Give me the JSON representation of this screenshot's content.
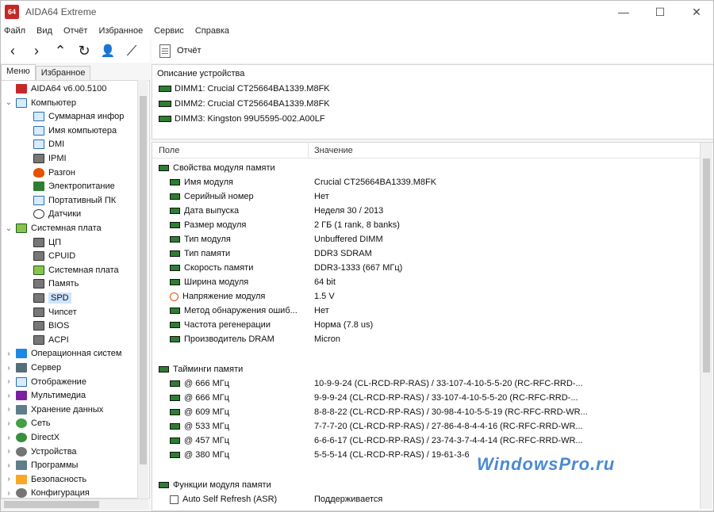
{
  "window": {
    "title": "AIDA64 Extreme",
    "min": "—",
    "max": "☐",
    "close": "✕",
    "logo_text": "64"
  },
  "menu": [
    "Файл",
    "Вид",
    "Отчёт",
    "Избранное",
    "Сервис",
    "Справка"
  ],
  "toolbar": {
    "back": "‹",
    "forward": "›",
    "up": "⌃",
    "refresh": "↻",
    "user": "👤",
    "chart": "⟋",
    "report_label": "Отчёт"
  },
  "tabs": {
    "menu": "Меню",
    "favorites": "Избранное"
  },
  "tree": [
    {
      "label": "AIDA64 v6.00.5100",
      "icon": "logo-icon",
      "level": 0,
      "expander": ""
    },
    {
      "label": "Компьютер",
      "icon": "monitor-icon",
      "level": 0,
      "expander": "⌄"
    },
    {
      "label": "Суммарная инфор",
      "icon": "monitor-icon",
      "level": 1,
      "expander": ""
    },
    {
      "label": "Имя компьютера",
      "icon": "monitor-icon",
      "level": 1,
      "expander": ""
    },
    {
      "label": "DMI",
      "icon": "monitor-icon",
      "level": 1,
      "expander": ""
    },
    {
      "label": "IPMI",
      "icon": "chip-icon",
      "level": 1,
      "expander": ""
    },
    {
      "label": "Разгон",
      "icon": "flame-icon",
      "level": 1,
      "expander": ""
    },
    {
      "label": "Электропитание",
      "icon": "plug-icon",
      "level": 1,
      "expander": ""
    },
    {
      "label": "Портативный ПК",
      "icon": "monitor-icon",
      "level": 1,
      "expander": ""
    },
    {
      "label": "Датчики",
      "icon": "clock-icon",
      "level": 1,
      "expander": ""
    },
    {
      "label": "Системная плата",
      "icon": "board-icon",
      "level": 0,
      "expander": "⌄"
    },
    {
      "label": "ЦП",
      "icon": "chip-icon",
      "level": 1,
      "expander": ""
    },
    {
      "label": "CPUID",
      "icon": "chip-icon",
      "level": 1,
      "expander": ""
    },
    {
      "label": "Системная плата",
      "icon": "board-icon",
      "level": 1,
      "expander": ""
    },
    {
      "label": "Память",
      "icon": "chip-icon",
      "level": 1,
      "expander": ""
    },
    {
      "label": "SPD",
      "icon": "chip-icon",
      "level": 1,
      "expander": "",
      "selected": true
    },
    {
      "label": "Чипсет",
      "icon": "chip-icon",
      "level": 1,
      "expander": ""
    },
    {
      "label": "BIOS",
      "icon": "chip-icon",
      "level": 1,
      "expander": ""
    },
    {
      "label": "ACPI",
      "icon": "chip-icon",
      "level": 1,
      "expander": ""
    },
    {
      "label": "Операционная систем",
      "icon": "windows-icon",
      "level": 0,
      "expander": "›"
    },
    {
      "label": "Сервер",
      "icon": "server-icon",
      "level": 0,
      "expander": "›"
    },
    {
      "label": "Отображение",
      "icon": "monitor-icon",
      "level": 0,
      "expander": "›"
    },
    {
      "label": "Мультимедиа",
      "icon": "media-icon",
      "level": 0,
      "expander": "›"
    },
    {
      "label": "Хранение данных",
      "icon": "storage-icon",
      "level": 0,
      "expander": "›"
    },
    {
      "label": "Сеть",
      "icon": "globe-icon",
      "level": 0,
      "expander": "›"
    },
    {
      "label": "DirectX",
      "icon": "xbox-icon",
      "level": 0,
      "expander": "›"
    },
    {
      "label": "Устройства",
      "icon": "gear-icon",
      "level": 0,
      "expander": "›"
    },
    {
      "label": "Программы",
      "icon": "storage-icon",
      "level": 0,
      "expander": "›"
    },
    {
      "label": "Безопасность",
      "icon": "shield-icon",
      "level": 0,
      "expander": "›"
    },
    {
      "label": "Конфигурация",
      "icon": "gear-icon",
      "level": 0,
      "expander": "›"
    }
  ],
  "device_description": {
    "header": "Описание устройства",
    "items": [
      "DIMM1: Crucial CT25664BA1339.M8FK",
      "DIMM2: Crucial CT25664BA1339.M8FK",
      "DIMM3: Kingston 99U5595-002.A00LF"
    ]
  },
  "columns": {
    "field": "Поле",
    "value": "Значение"
  },
  "groups": [
    {
      "title": "Свойства модуля памяти",
      "rows": [
        {
          "field": "Имя модуля",
          "value": "Crucial CT25664BA1339.M8FK",
          "icon": "ram"
        },
        {
          "field": "Серийный номер",
          "value": "Нет",
          "icon": "ram"
        },
        {
          "field": "Дата выпуска",
          "value": "Неделя 30 / 2013",
          "icon": "ram"
        },
        {
          "field": "Размер модуля",
          "value": "2 ГБ (1 rank, 8 banks)",
          "icon": "ram"
        },
        {
          "field": "Тип модуля",
          "value": "Unbuffered DIMM",
          "icon": "ram"
        },
        {
          "field": "Тип памяти",
          "value": "DDR3 SDRAM",
          "icon": "ram"
        },
        {
          "field": "Скорость памяти",
          "value": "DDR3-1333 (667 МГц)",
          "icon": "ram"
        },
        {
          "field": "Ширина модуля",
          "value": "64 bit",
          "icon": "ram"
        },
        {
          "field": "Напряжение модуля",
          "value": "1.5 V",
          "icon": "volt"
        },
        {
          "field": "Метод обнаружения ошиб...",
          "value": "Нет",
          "icon": "ram"
        },
        {
          "field": "Частота регенерации",
          "value": "Норма (7.8 us)",
          "icon": "ram"
        },
        {
          "field": "Производитель DRAM",
          "value": "Micron",
          "icon": "ram"
        }
      ]
    },
    {
      "title": "Тайминги памяти",
      "rows": [
        {
          "field": "@ 666 МГц",
          "value": "10-9-9-24  (CL-RCD-RP-RAS) / 33-107-4-10-5-5-20  (RC-RFC-RRD-...",
          "icon": "ram"
        },
        {
          "field": "@ 666 МГц",
          "value": "9-9-9-24  (CL-RCD-RP-RAS) / 33-107-4-10-5-5-20  (RC-RFC-RRD-...",
          "icon": "ram"
        },
        {
          "field": "@ 609 МГц",
          "value": "8-8-8-22  (CL-RCD-RP-RAS) / 30-98-4-10-5-5-19  (RC-RFC-RRD-WR...",
          "icon": "ram"
        },
        {
          "field": "@ 533 МГц",
          "value": "7-7-7-20  (CL-RCD-RP-RAS) / 27-86-4-8-4-4-16  (RC-RFC-RRD-WR...",
          "icon": "ram"
        },
        {
          "field": "@ 457 МГц",
          "value": "6-6-6-17  (CL-RCD-RP-RAS) / 23-74-3-7-4-4-14  (RC-RFC-RRD-WR...",
          "icon": "ram"
        },
        {
          "field": "@ 380 МГц",
          "value": "5-5-5-14  (CL-RCD-RP-RAS) / 19-61-3-6",
          "icon": "ram"
        }
      ]
    },
    {
      "title": "Функции модуля памяти",
      "rows": [
        {
          "field": "Auto Self Refresh (ASR)",
          "value": "Поддерживается",
          "icon": "check"
        }
      ]
    }
  ],
  "watermark": "WindowsPro.ru"
}
